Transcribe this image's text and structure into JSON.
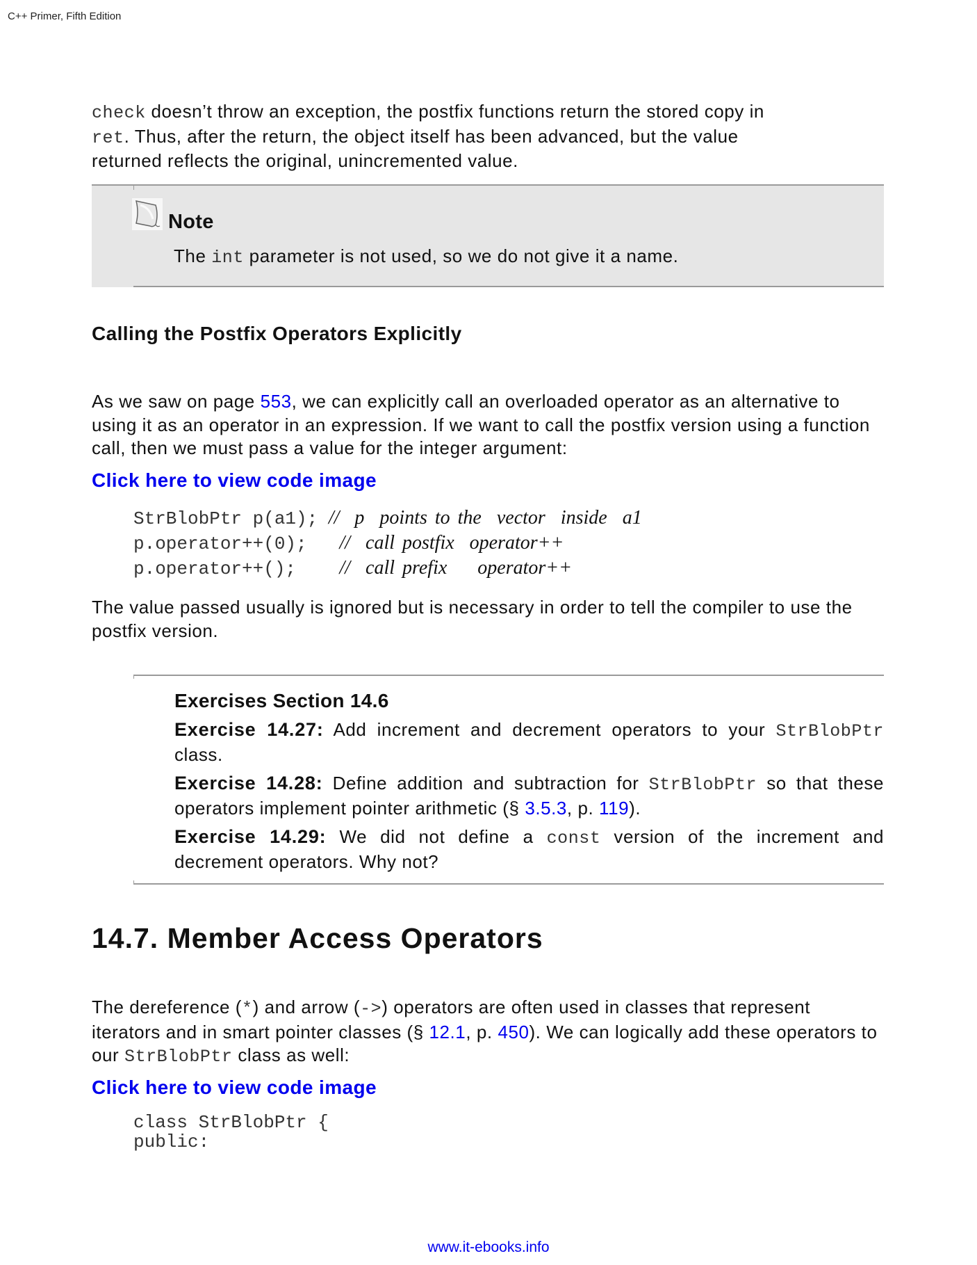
{
  "running_head": "C++ Primer, Fifth Edition",
  "intro": {
    "line1_code": "check",
    "line1_text": " doesn’t throw an exception, the postfix functions return the stored copy in",
    "line2_code": "ret",
    "line2_text": ". Thus, after the return, the object itself has been advanced, but the value",
    "line3_text": "returned reflects the original, unincremented value."
  },
  "note": {
    "icon": "note-paper-icon",
    "title": "Note",
    "text_before": "The ",
    "code": "int",
    "text_after": " parameter is not used, so we do not give it a name."
  },
  "subheading": "Calling the Postfix Operators Explicitly",
  "para1": {
    "text_before": "As we saw on page ",
    "link_page": "553",
    "text_after": ", we can explicitly call an overloaded operator as an alternative to using it as an operator in an expression. If we want to call the postfix version using a function call, then we must pass a value for the integer argument:"
  },
  "code_link_label": "Click here to view code image",
  "code1": [
    {
      "code": "StrBlobPtr p(a1); ",
      "comment": "//  p  points to the  vector  inside  a1"
    },
    {
      "code": "p.operator++(0);   ",
      "comment": "//  call postfix  operator++"
    },
    {
      "code": "p.operator++();    ",
      "comment": "//  call prefix    operator++"
    }
  ],
  "para2": "The value passed usually is ignored but is necessary in order to tell the compiler to use the postfix version.",
  "exercises": {
    "title": "Exercises Section 14.6",
    "items": [
      {
        "label": "Exercise 14.27:",
        "text_before": " Add increment and decrement operators to your ",
        "code": "StrBlobPtr",
        "text_after": " class."
      },
      {
        "label": "Exercise 14.28:",
        "text_before": " Define addition and subtraction for ",
        "code": "StrBlobPtr",
        "text_mid": " so that these operators implement pointer arithmetic (§ ",
        "link_section": "3.5.3",
        "text_mid2": ", p. ",
        "link_page": "119",
        "text_after": ")."
      },
      {
        "label": "Exercise 14.29:",
        "text_before": " We did not define a ",
        "code": "const",
        "text_after": " version of the increment and decrement operators. Why not?"
      }
    ]
  },
  "section_heading": "14.7. Member Access Operators",
  "para3": {
    "text1": "The dereference (",
    "code1": "*",
    "text2": ") and arrow (",
    "code2": "->",
    "text3": ") operators are often used in classes that represent iterators and in smart pointer classes (§ ",
    "link_section": "12.1",
    "text4": ", p. ",
    "link_page": "450",
    "text5": "). We can logically add these operators to our ",
    "code3": "StrBlobPtr",
    "text6": " class as well:"
  },
  "code2": [
    "class StrBlobPtr {",
    "public:"
  ],
  "footer_link": "www.it-ebooks.info",
  "colors": {
    "link": "#0000ee",
    "note_bg": "#e6e6e6",
    "rule": "#9a9a9a"
  }
}
